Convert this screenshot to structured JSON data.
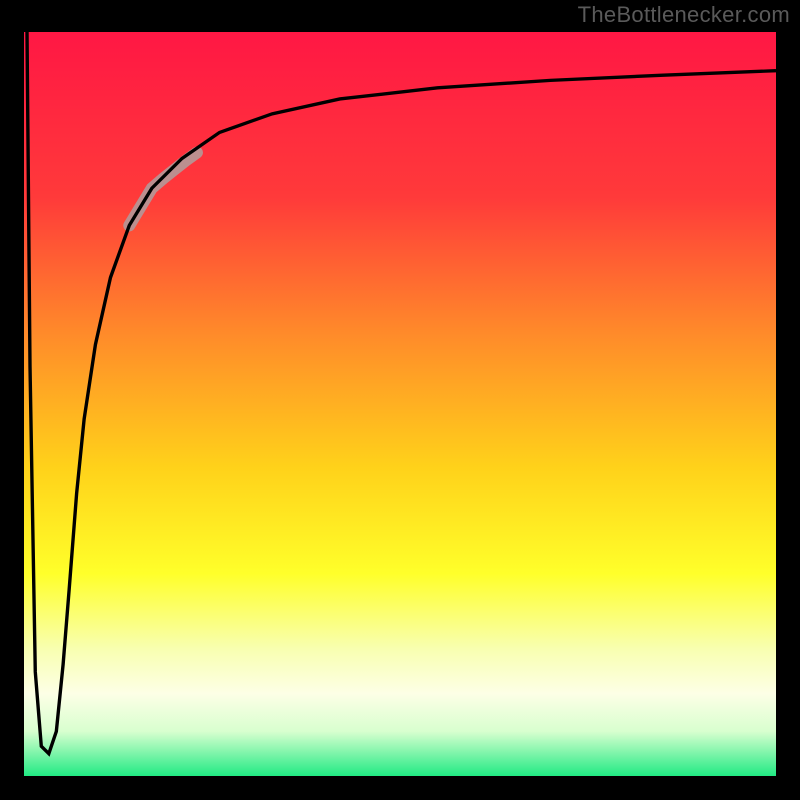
{
  "attribution": "TheBottlenecker.com",
  "chart_data": {
    "type": "line",
    "title": "",
    "xlabel": "",
    "ylabel": "",
    "xlim": [
      0,
      100
    ],
    "ylim": [
      0,
      100
    ],
    "gradient_stops": [
      {
        "offset": 0,
        "color": "#ff1744"
      },
      {
        "offset": 22,
        "color": "#ff3a3a"
      },
      {
        "offset": 40,
        "color": "#ff8a2a"
      },
      {
        "offset": 58,
        "color": "#ffd21a"
      },
      {
        "offset": 72,
        "color": "#ffff2a"
      },
      {
        "offset": 82,
        "color": "#f8ffb0"
      },
      {
        "offset": 88,
        "color": "#fdffe6"
      },
      {
        "offset": 93,
        "color": "#d8ffcf"
      },
      {
        "offset": 100,
        "color": "#00e676"
      }
    ],
    "series": [
      {
        "name": "bottleneck-curve",
        "x": [
          0.4,
          0.8,
          1.5,
          2.3,
          3.3,
          4.3,
          5.2,
          6.0,
          7.0,
          8.0,
          9.5,
          11.5,
          14.0,
          17.0,
          21.0,
          26.0,
          33.0,
          42.0,
          55.0,
          70.0,
          85.0,
          100.0
        ],
        "y": [
          100,
          55,
          14,
          4,
          3,
          6,
          15,
          25,
          38,
          48,
          58,
          67,
          74,
          79,
          83,
          86.5,
          89,
          91,
          92.5,
          93.5,
          94.2,
          94.8
        ]
      },
      {
        "name": "highlight-segment",
        "x": [
          14.0,
          15.5,
          17.0,
          18.5,
          20.0,
          21.5,
          23.0
        ],
        "y": [
          74.0,
          76.5,
          79.0,
          80.3,
          81.5,
          82.7,
          83.8
        ]
      }
    ],
    "highlight_color": "#bb8f8f",
    "curve_color": "#000000"
  }
}
